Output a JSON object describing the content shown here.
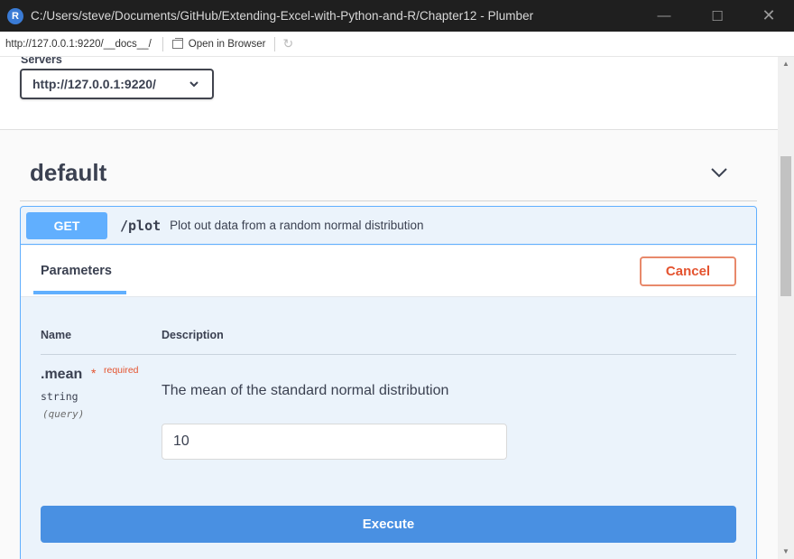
{
  "window": {
    "title": "C:/Users/steve/Documents/GitHub/Extending-Excel-with-Python-and-R/Chapter12 - Plumber",
    "app_icon_letter": "R",
    "controls": {
      "minimize": "—",
      "maximize": "☐",
      "close": "✕"
    }
  },
  "address_bar": {
    "url": "http://127.0.0.1:9220/__docs__/",
    "open_in_browser": "Open in Browser",
    "refresh_icon": "↻"
  },
  "servers": {
    "label": "Servers",
    "selected": "http://127.0.0.1:9220/"
  },
  "tag": {
    "name": "default"
  },
  "operation": {
    "method": "GET",
    "path": "/plot",
    "summary": "Plot out data from a random normal distribution",
    "accent_color": "#61affe"
  },
  "parameters": {
    "tab_label": "Parameters",
    "cancel_label": "Cancel",
    "columns": {
      "name": "Name",
      "description": "Description"
    },
    "items": [
      {
        "name": ".mean",
        "required_star": "*",
        "required_text": "required",
        "type": "string",
        "in": "(query)",
        "description": "The mean of the standard normal distribution",
        "value": "10"
      }
    ]
  },
  "execute": {
    "label": "Execute",
    "color": "#4990e2"
  }
}
